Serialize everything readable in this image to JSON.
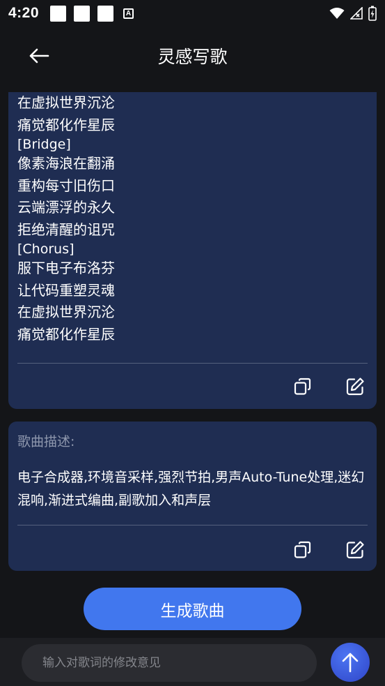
{
  "status_bar": {
    "time": "4:20"
  },
  "header": {
    "title": "灵感写歌"
  },
  "lyrics": {
    "lines": [
      "在虚拟世界沉沦",
      "痛觉都化作星辰",
      "[Bridge]",
      "像素海浪在翻涌",
      "重构每寸旧伤口",
      "云端漂浮的永久",
      "拒绝清醒的诅咒",
      "[Chorus]",
      "服下电子布洛芬",
      "让代码重塑灵魂",
      "在虚拟世界沉沦",
      "痛觉都化作星辰"
    ]
  },
  "description": {
    "label": "歌曲描述:",
    "text": "电子合成器,环境音采样,强烈节拍,男声Auto-Tune处理,迷幻混响,渐进式编曲,副歌加入和声层"
  },
  "actions": {
    "generate_label": "生成歌曲"
  },
  "feedback": {
    "placeholder": "输入对歌词的修改意见",
    "value": ""
  },
  "colors": {
    "background": "#141518",
    "card": "#1f2d52",
    "accent": "#4177ee",
    "send_button": "#3a56dc"
  }
}
